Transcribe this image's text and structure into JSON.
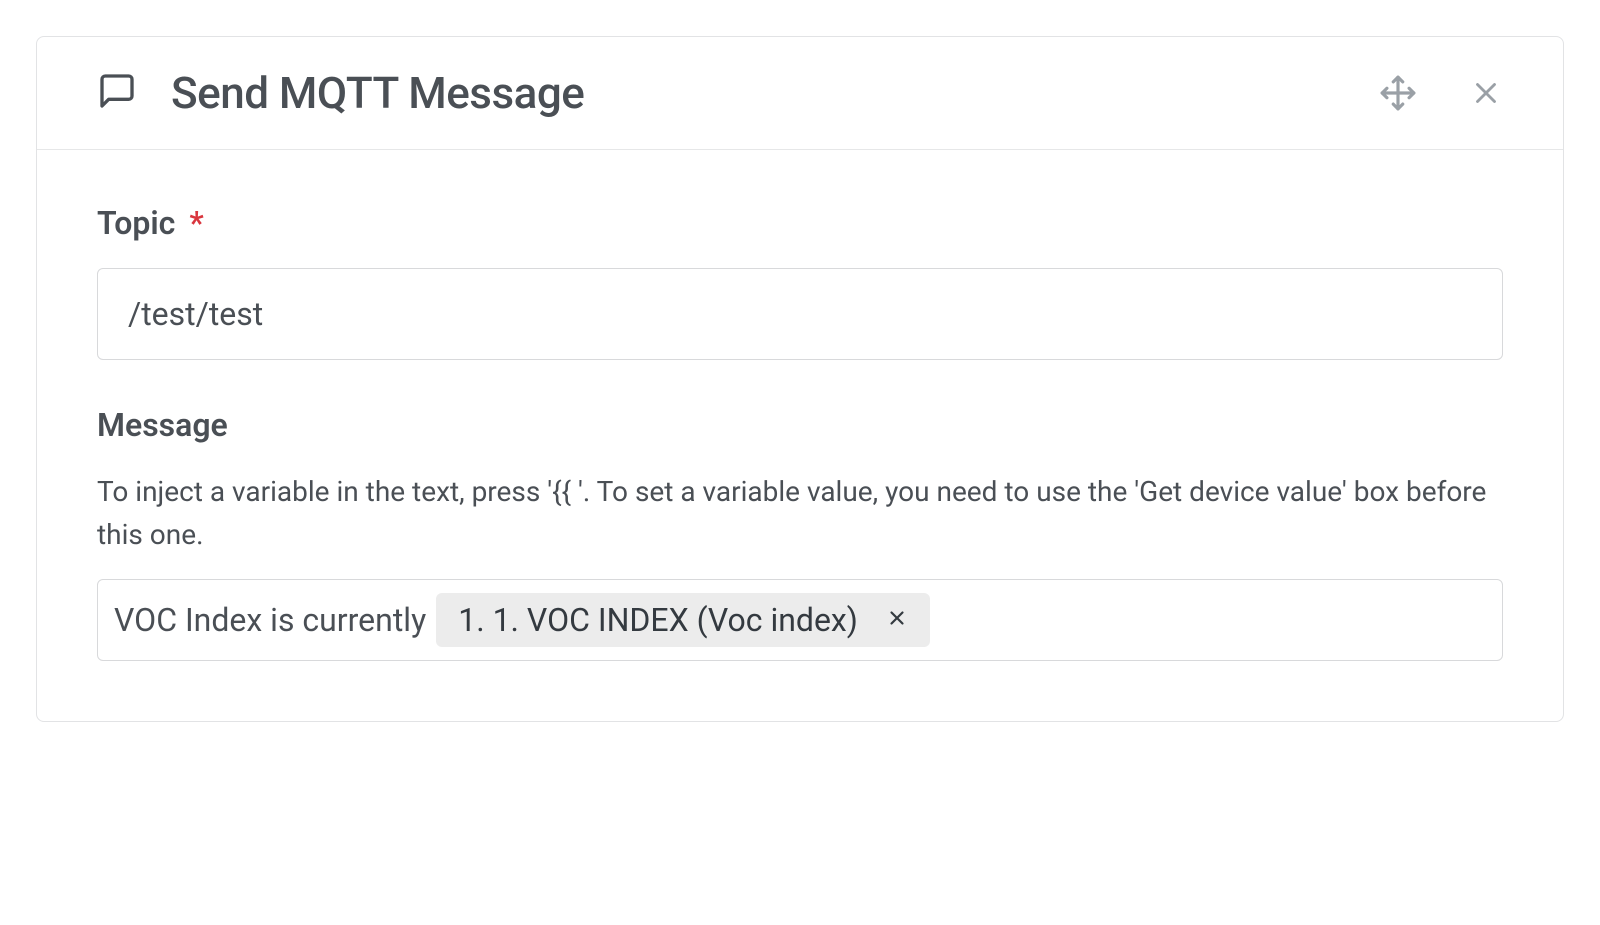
{
  "card": {
    "title": "Send MQTT Message"
  },
  "topic": {
    "label": "Topic",
    "required_marker": "*",
    "value": "/test/test"
  },
  "message": {
    "label": "Message",
    "help_text": "To inject a variable in the text, press '{{ '. To set a variable value, you need to use the 'Get device value' box before this one.",
    "prefix_text": "VOC Index is currently",
    "chip_label": "1. 1. VOC INDEX (Voc index)"
  }
}
